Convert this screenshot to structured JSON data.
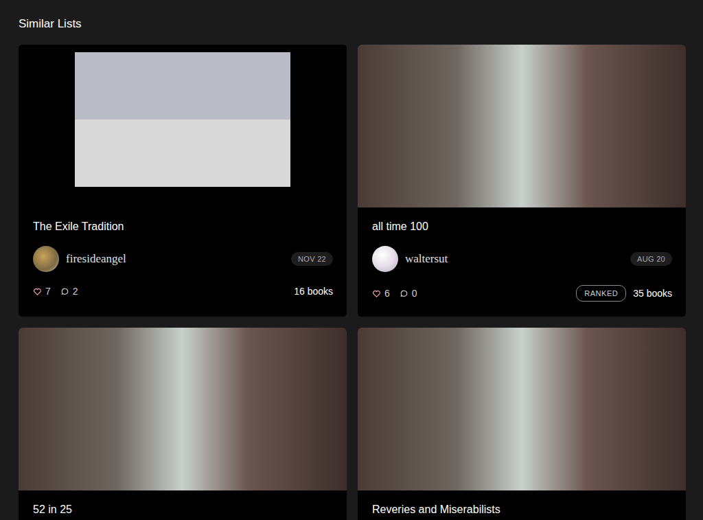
{
  "section": {
    "title": "Similar Lists"
  },
  "lists": [
    {
      "title": "The Exile Tradition",
      "user": "firesideangel",
      "date": "NOV 22",
      "likes": "7",
      "comments": "2",
      "badge": "",
      "books": "16 books"
    },
    {
      "title": "all time 100",
      "user": "waltersut",
      "date": "AUG 20",
      "likes": "6",
      "comments": "0",
      "badge": "RANKED",
      "books": "35 books"
    },
    {
      "title": "52 in 25"
    },
    {
      "title": "Reveries and Miserabilists"
    }
  ]
}
